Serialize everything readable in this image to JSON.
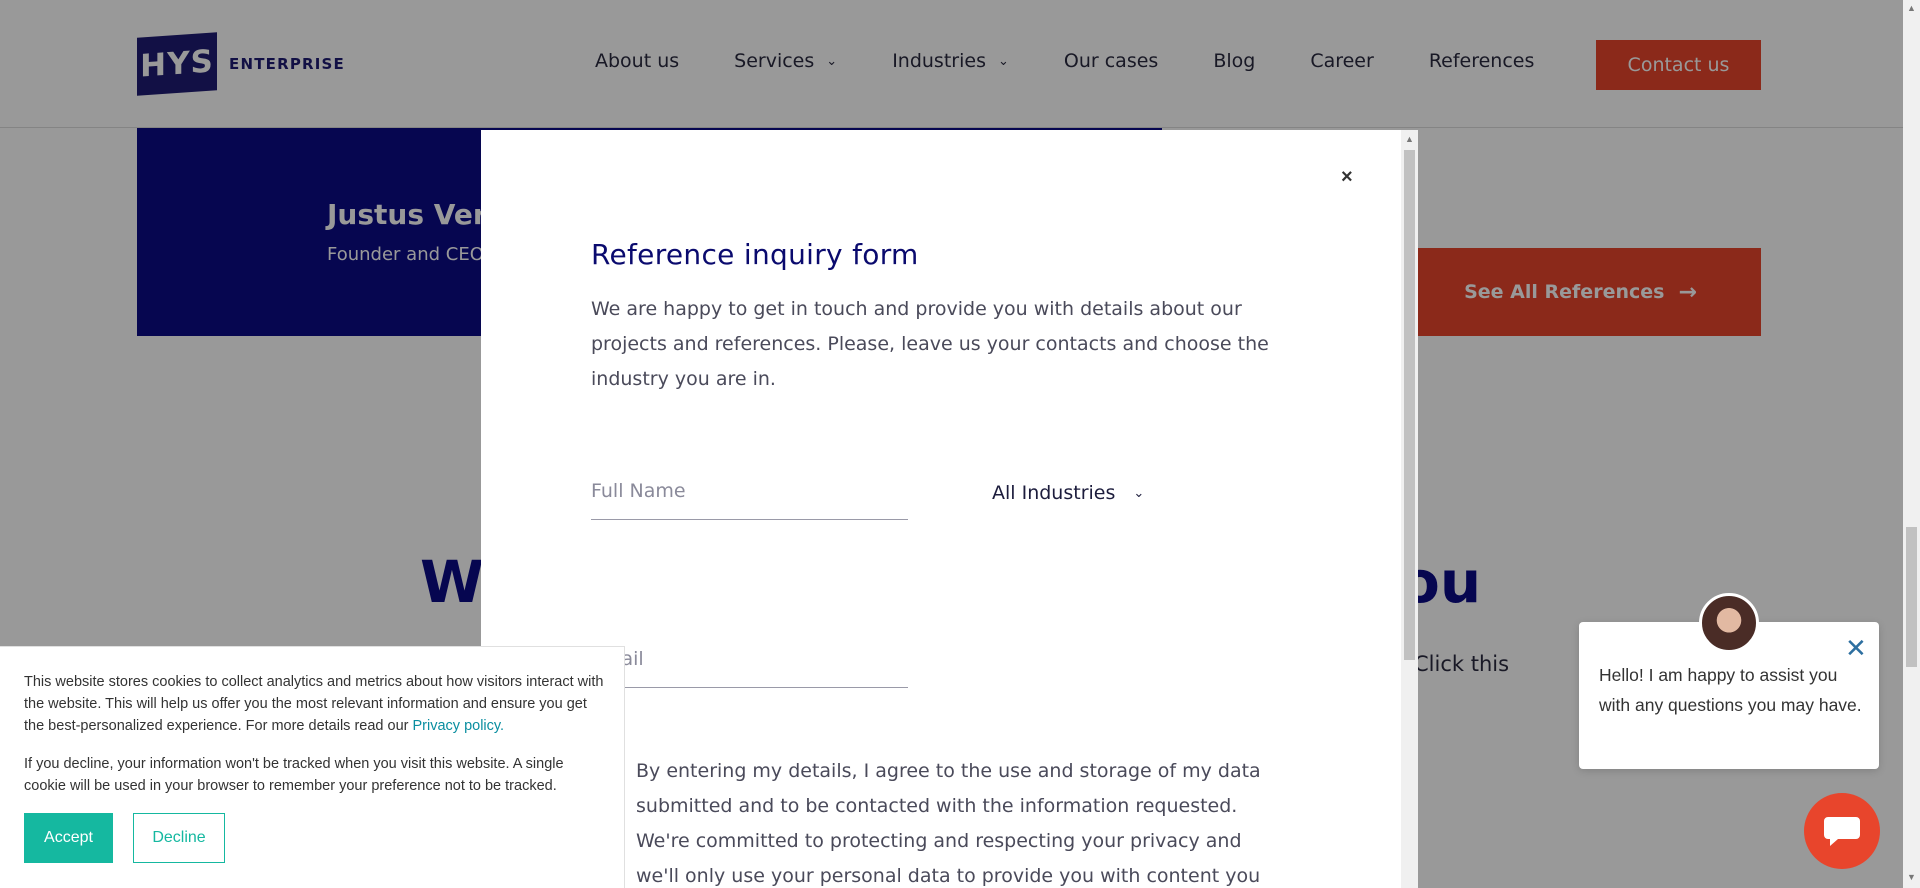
{
  "header": {
    "logo_mark": "HYS",
    "logo_text": "ENTERPRISE",
    "nav": [
      {
        "label": "About us",
        "dropdown": false
      },
      {
        "label": "Services",
        "dropdown": true
      },
      {
        "label": "Industries",
        "dropdown": true
      },
      {
        "label": "Our cases",
        "dropdown": false
      },
      {
        "label": "Blog",
        "dropdown": false
      },
      {
        "label": "Career",
        "dropdown": false
      },
      {
        "label": "References",
        "dropdown": false
      }
    ],
    "contact_label": "Contact us"
  },
  "testimonial": {
    "name": "Justus Verl",
    "role": "Founder and CEO"
  },
  "see_all_label": "See All References",
  "heading_left": "We",
  "heading_right": "ou",
  "click_this": "Click this",
  "modal": {
    "title": "Reference inquiry form",
    "description": "We are happy to get in touch and provide you with details about our projects and references. Please, leave us your contacts and choose the industry you are in.",
    "name_placeholder": "Full Name",
    "email_placeholder": "Email",
    "industry_selected": "All Industries",
    "consent_text": "By entering my details, I agree to the use and storage of my data submitted and to be contacted with the information requested. We're committed to protecting and respecting your privacy and we'll only use your personal data to provide you with content you are",
    "close_label": "×"
  },
  "cookie": {
    "text1": "This website stores cookies to collect analytics and metrics about how visitors interact with the website. This will help us offer you the most relevant information and ensure you get the best-personalized experience. For more details read our",
    "privacy_link": "Privacy policy.",
    "text2": "If you decline, your information won't be tracked when you visit this website. A single cookie will be used in your browser to remember your preference not to be tracked.",
    "accept_label": "Accept",
    "decline_label": "Decline"
  },
  "chat": {
    "message": "Hello! I am happy to assist you with any questions you may have."
  },
  "colors": {
    "brand_navy": "#0a0a86",
    "accent_orange": "#e8452c",
    "cookie_teal": "#15b8a0"
  },
  "icons": [
    "chevron-down-icon",
    "arrow-right-icon",
    "close-icon",
    "chat-icon",
    "avatar"
  ]
}
